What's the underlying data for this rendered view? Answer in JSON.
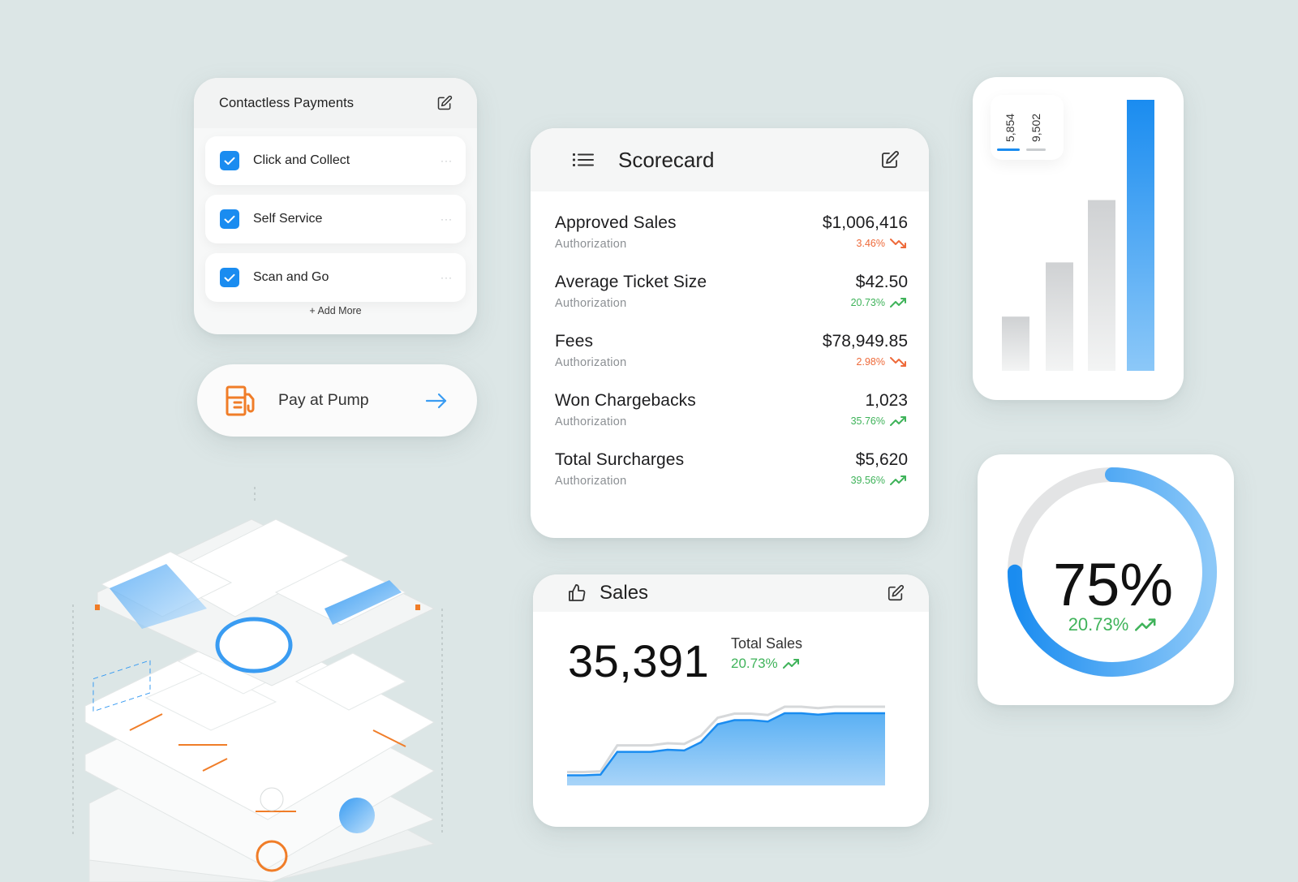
{
  "contactless": {
    "title": "Contactless Payments",
    "options": [
      {
        "label": "Click and Collect",
        "checked": true
      },
      {
        "label": "Self Service",
        "checked": true
      },
      {
        "label": "Scan and Go",
        "checked": true
      }
    ],
    "add_more": "+ Add More"
  },
  "pump": {
    "label": "Pay at Pump"
  },
  "scorecard": {
    "title": "Scorecard",
    "rows": [
      {
        "name": "Approved Sales",
        "sub": "Authorization",
        "value": "$1,006,416",
        "change": "3.46%",
        "trend": "down"
      },
      {
        "name": "Average Ticket Size",
        "sub": "Authorization",
        "value": "$42.50",
        "change": "20.73%",
        "trend": "up"
      },
      {
        "name": "Fees",
        "sub": "Authorization",
        "value": "$78,949.85",
        "change": "2.98%",
        "trend": "down"
      },
      {
        "name": "Won Chargebacks",
        "sub": "Authorization",
        "value": "1,023",
        "change": "35.76%",
        "trend": "up"
      },
      {
        "name": "Total Surcharges",
        "sub": "Authorization",
        "value": "$5,620",
        "change": "39.56%",
        "trend": "up"
      }
    ]
  },
  "sales": {
    "title": "Sales",
    "total": "35,391",
    "total_label": "Total Sales",
    "change": "20.73%"
  },
  "bars": {
    "legend": [
      "5,854",
      "9,502"
    ]
  },
  "gauge": {
    "percent_label": "75%",
    "percent_value": 75,
    "change": "20.73%"
  },
  "colors": {
    "accent_blue": "#1a8cf0",
    "up_green": "#3fb35a",
    "down_orange": "#ee6a3a",
    "pump_orange": "#f07d28"
  },
  "chart_data": [
    {
      "type": "bar",
      "title": "",
      "categories": [
        "",
        "",
        "",
        ""
      ],
      "values": [
        20,
        40,
        63,
        100
      ],
      "xlabel": "",
      "ylabel": "",
      "ylim": [
        0,
        100
      ],
      "grid": false
    },
    {
      "type": "area",
      "title": "",
      "x": [
        0,
        1,
        2,
        3,
        4,
        5,
        6,
        7,
        8,
        9,
        10,
        11,
        12,
        13,
        14,
        15,
        16,
        17,
        18,
        19
      ],
      "values": [
        10,
        10,
        11,
        44,
        44,
        44,
        47,
        46,
        58,
        84,
        90,
        90,
        88,
        100,
        100,
        98,
        100,
        100,
        100,
        100
      ],
      "ylim": [
        0,
        120
      ],
      "grid": false
    }
  ]
}
